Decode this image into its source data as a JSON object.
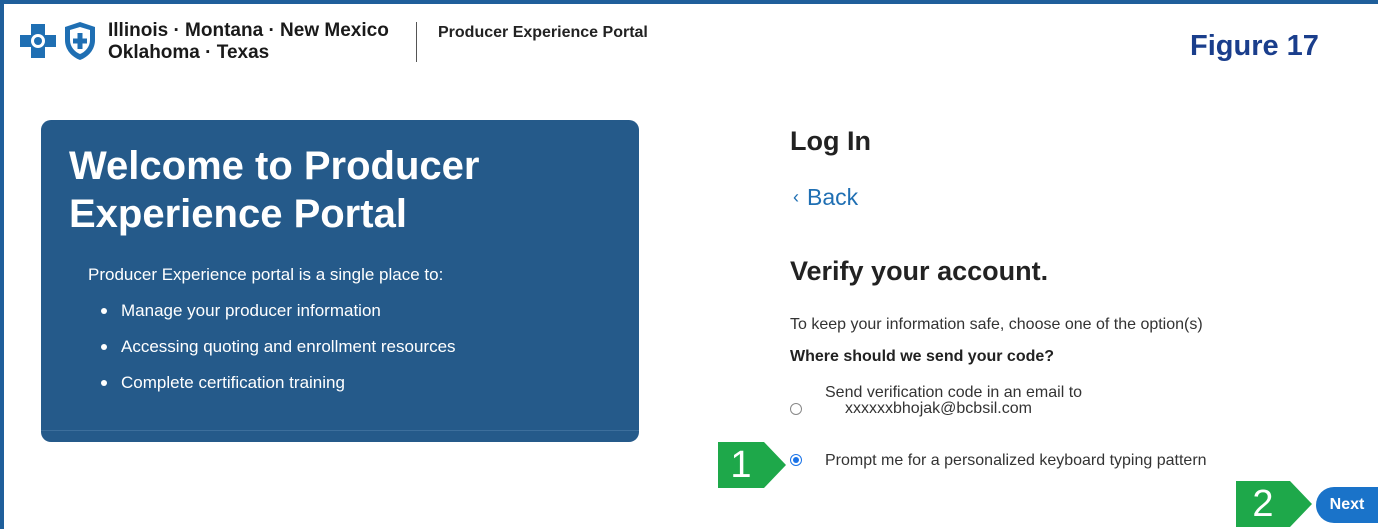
{
  "header": {
    "brand_line1": "Illinois · Montana · New Mexico",
    "brand_line2": "Oklahoma · Texas",
    "portal_name": "Producer Experience Portal",
    "figure_label": "Figure 17"
  },
  "welcome": {
    "title": "Welcome to Producer Experience Portal",
    "intro": "Producer Experience portal is a single place to:",
    "items": [
      "Manage your producer information",
      "Accessing quoting and enrollment resources",
      "Complete certification training"
    ]
  },
  "login": {
    "heading": "Log In",
    "back_label": "Back",
    "verify_heading": "Verify your account.",
    "info_text": "To keep your information safe, choose one of the option(s)",
    "question": "Where should we send your code?",
    "options": [
      {
        "line1": "Send verification code in an email to",
        "line2": "xxxxxxbhojak@bcbsil.com",
        "selected": false
      },
      {
        "line1": "Prompt me for a personalized keyboard typing pattern",
        "selected": true
      }
    ],
    "next_label": "Next"
  },
  "callouts": [
    "1",
    "2"
  ],
  "colors": {
    "accent": "#1f5f9b",
    "card_background": "#255a8a",
    "link": "#1f6fb3",
    "callout": "#1ea84a",
    "figure_label": "#1a3e8c",
    "button": "#1a73c9"
  }
}
